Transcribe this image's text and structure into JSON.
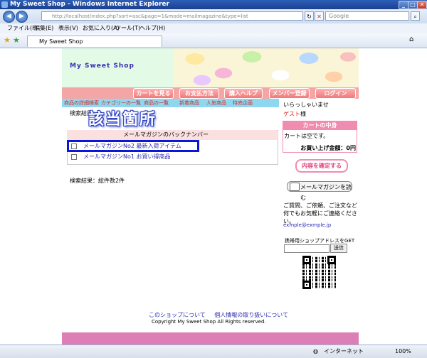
{
  "window": {
    "title": "My Sweet Shop - Windows Internet Explorer"
  },
  "addressbar": {
    "url": "http://localhost/index.php?sort=asc&page=1&mode=mailmagazine&type=list",
    "search_placeholder": "Google"
  },
  "menu": [
    "ファイル(F)",
    "編集(E)",
    "表示(V)",
    "お気に入り(A)",
    "ツール(T)",
    "ヘルプ(H)"
  ],
  "tab": {
    "label": "My Sweet Shop"
  },
  "shop": {
    "title": "My Sweet Shop"
  },
  "nav": [
    "カートを見る",
    "お支払方法",
    "購入ヘルプ",
    "メンバー登録",
    "ログイン"
  ],
  "categories": [
    "商品の詳細検索",
    "カテゴリーの一覧",
    "商品の一覧",
    "新着商品",
    "人気商品",
    "特売企画"
  ],
  "search": {
    "label": "検索結果",
    "result": "検索結果：総件数2件"
  },
  "annotation": "該当箇所",
  "magazine": {
    "header": "メールマガジンのバックナンバー",
    "items": [
      "メールマガジンNo2 最新入荷アイテム",
      "メールマガジンNo1 お買い得商品"
    ]
  },
  "sidebar": {
    "welcome": "いらっしゃいませ",
    "guest_name": "ゲスト",
    "guest_suffix": "様",
    "cart_title": "カートの中身",
    "cart_empty": "カートは空です。",
    "cart_total": "お買い上げ金額：0円",
    "confirm_button": "内容を確定する",
    "mail_button": "メールマガジンを読む",
    "info": "ご質問、ご依頼、ご注文など何でもお気軽にご連絡ください。",
    "email": "exmple@exmple.jp",
    "mobile_label": "携帯用ショップアドレスをGET",
    "send_button": "送信"
  },
  "footer": {
    "links": [
      "このショップについて",
      "個人情報の取り扱いについて"
    ],
    "copyright": "Copyright My Sweet Shop All Rights reserved."
  },
  "status": {
    "zone": "インターネット",
    "zoom": "100%"
  }
}
